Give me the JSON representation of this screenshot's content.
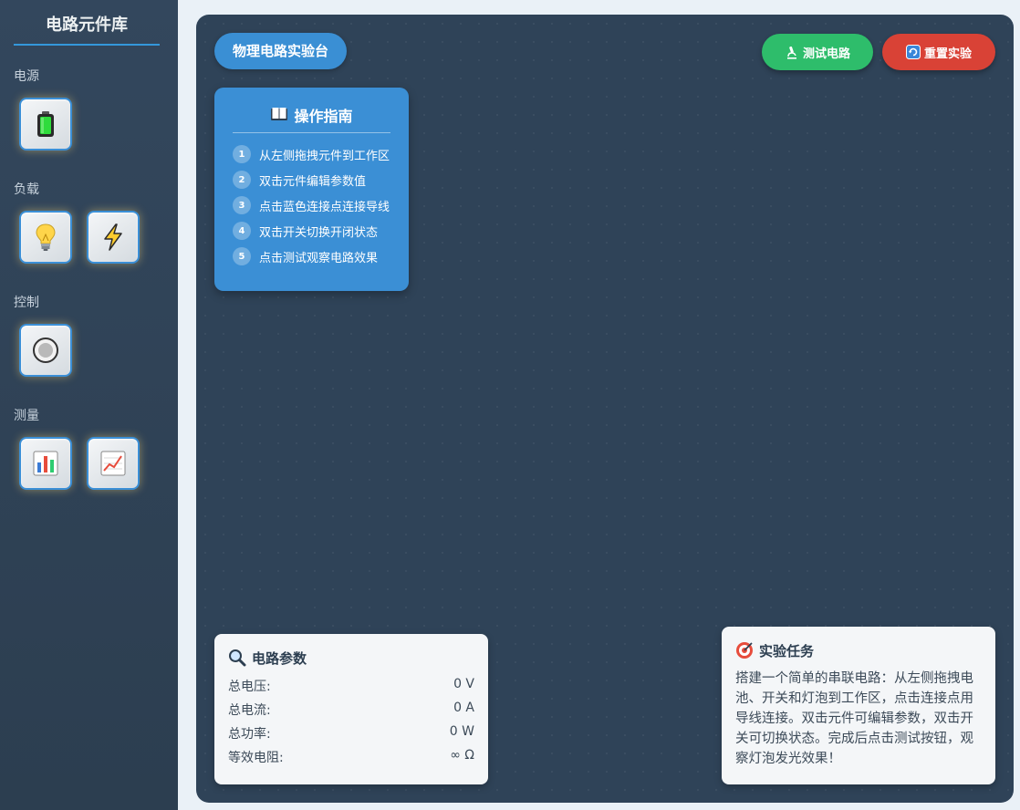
{
  "sidebar": {
    "title": "电路元件库",
    "categories": [
      {
        "label": "电源",
        "items": [
          {
            "icon": "battery-icon"
          }
        ]
      },
      {
        "label": "负载",
        "items": [
          {
            "icon": "light-bulb-icon"
          },
          {
            "icon": "lightning-icon"
          }
        ]
      },
      {
        "label": "控制",
        "items": [
          {
            "icon": "switch-button-icon"
          }
        ]
      },
      {
        "label": "测量",
        "items": [
          {
            "icon": "bar-chart-icon"
          },
          {
            "icon": "line-chart-icon"
          }
        ]
      }
    ]
  },
  "workspace": {
    "title": "物理电路实验台",
    "test_button": "测试电路",
    "reset_button": "重置实验"
  },
  "guide": {
    "title": "操作指南",
    "steps": [
      {
        "num": "1",
        "text": "从左侧拖拽元件到工作区"
      },
      {
        "num": "2",
        "text": "双击元件编辑参数值"
      },
      {
        "num": "3",
        "text": "点击蓝色连接点连接导线"
      },
      {
        "num": "4",
        "text": "双击开关切换开闭状态"
      },
      {
        "num": "5",
        "text": "点击测试观察电路效果"
      }
    ]
  },
  "params": {
    "title": "电路参数",
    "rows": [
      {
        "label": "总电压:",
        "value": "0 V"
      },
      {
        "label": "总电流:",
        "value": "0 A"
      },
      {
        "label": "总功率:",
        "value": "0 W"
      },
      {
        "label": "等效电阻:",
        "value": "∞ Ω"
      }
    ]
  },
  "task": {
    "title": "实验任务",
    "text": "搭建一个简单的串联电路：从左侧拖拽电池、开关和灯泡到工作区，点击连接点用导线连接。双击元件可编辑参数，双击开关可切换状态。完成后点击测试按钮，观察灯泡发光效果！"
  },
  "colors": {
    "sidebar_bg": "#2c3e50",
    "workspace_bg": "#2f4358",
    "accent_blue": "#3b8fd5",
    "test_green": "#2ebd6b",
    "reset_red": "#d94236"
  }
}
